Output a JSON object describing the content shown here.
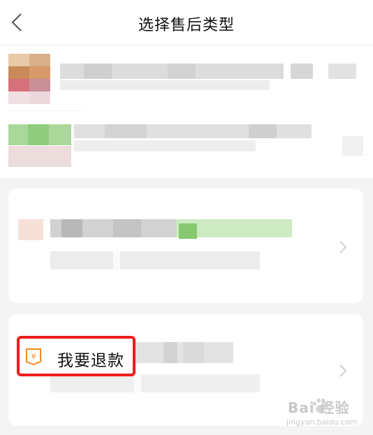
{
  "header": {
    "title": "选择售后类型",
    "back_icon": "chevron-left-icon"
  },
  "refund_option": {
    "label": "我要退款",
    "icon": "yuan-tag-icon",
    "accent": "#f08a24"
  },
  "highlight_color": "#ee1c1c",
  "watermark": {
    "main": "Bai 经验",
    "sub": "jingyan.baidu.com"
  }
}
